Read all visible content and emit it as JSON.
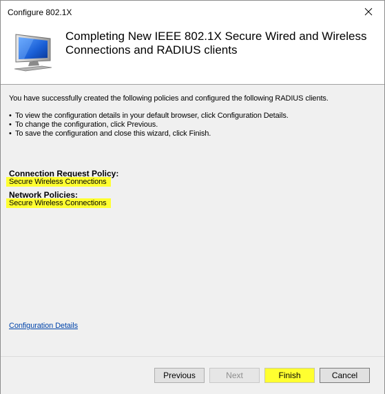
{
  "window": {
    "title": "Configure 802.1X"
  },
  "header": {
    "title": "Completing New IEEE 802.1X Secure Wired and Wireless Connections and RADIUS clients",
    "icon": "computer-monitor-icon"
  },
  "content": {
    "intro": "You have successfully created the following policies and configured the following RADIUS clients.",
    "bullets": [
      "To view the configuration details in your default browser, click Configuration Details.",
      "To change the configuration, click Previous.",
      "To save the configuration and close this wizard, click Finish."
    ],
    "connection_request_policy_label": "Connection Request Policy:",
    "connection_request_policy_value": "Secure Wireless Connections",
    "network_policies_label": "Network Policies:",
    "network_policies_value": "Secure Wireless Connections",
    "config_details_link": "Configuration Details"
  },
  "footer": {
    "previous_label": "Previous",
    "next_label": "Next",
    "finish_label": "Finish",
    "cancel_label": "Cancel"
  },
  "colors": {
    "highlight": "#ffff30",
    "content_bg": "#f0f0f0",
    "link": "#0044aa"
  }
}
